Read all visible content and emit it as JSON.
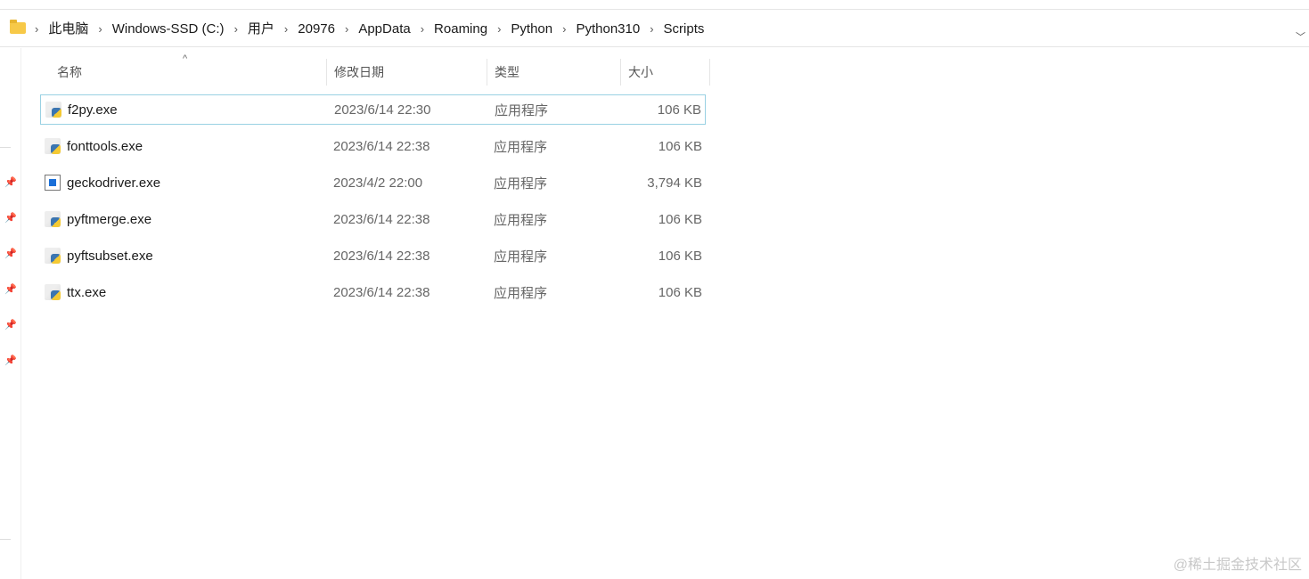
{
  "breadcrumb": [
    "此电脑",
    "Windows-SSD (C:)",
    "用户",
    "20976",
    "AppData",
    "Roaming",
    "Python",
    "Python310",
    "Scripts"
  ],
  "columns": {
    "name": "名称",
    "date": "修改日期",
    "type": "类型",
    "size": "大小"
  },
  "files": [
    {
      "name": "f2py.exe",
      "date": "2023/6/14 22:30",
      "type": "应用程序",
      "size": "106 KB",
      "icon": "python-exe-icon"
    },
    {
      "name": "fonttools.exe",
      "date": "2023/6/14 22:38",
      "type": "应用程序",
      "size": "106 KB",
      "icon": "python-exe-icon"
    },
    {
      "name": "geckodriver.exe",
      "date": "2023/4/2 22:00",
      "type": "应用程序",
      "size": "3,794 KB",
      "icon": "application-icon"
    },
    {
      "name": "pyftmerge.exe",
      "date": "2023/6/14 22:38",
      "type": "应用程序",
      "size": "106 KB",
      "icon": "python-exe-icon"
    },
    {
      "name": "pyftsubset.exe",
      "date": "2023/6/14 22:38",
      "type": "应用程序",
      "size": "106 KB",
      "icon": "python-exe-icon"
    },
    {
      "name": "ttx.exe",
      "date": "2023/6/14 22:38",
      "type": "应用程序",
      "size": "106 KB",
      "icon": "python-exe-icon"
    }
  ],
  "watermark": "@稀土掘金技术社区"
}
